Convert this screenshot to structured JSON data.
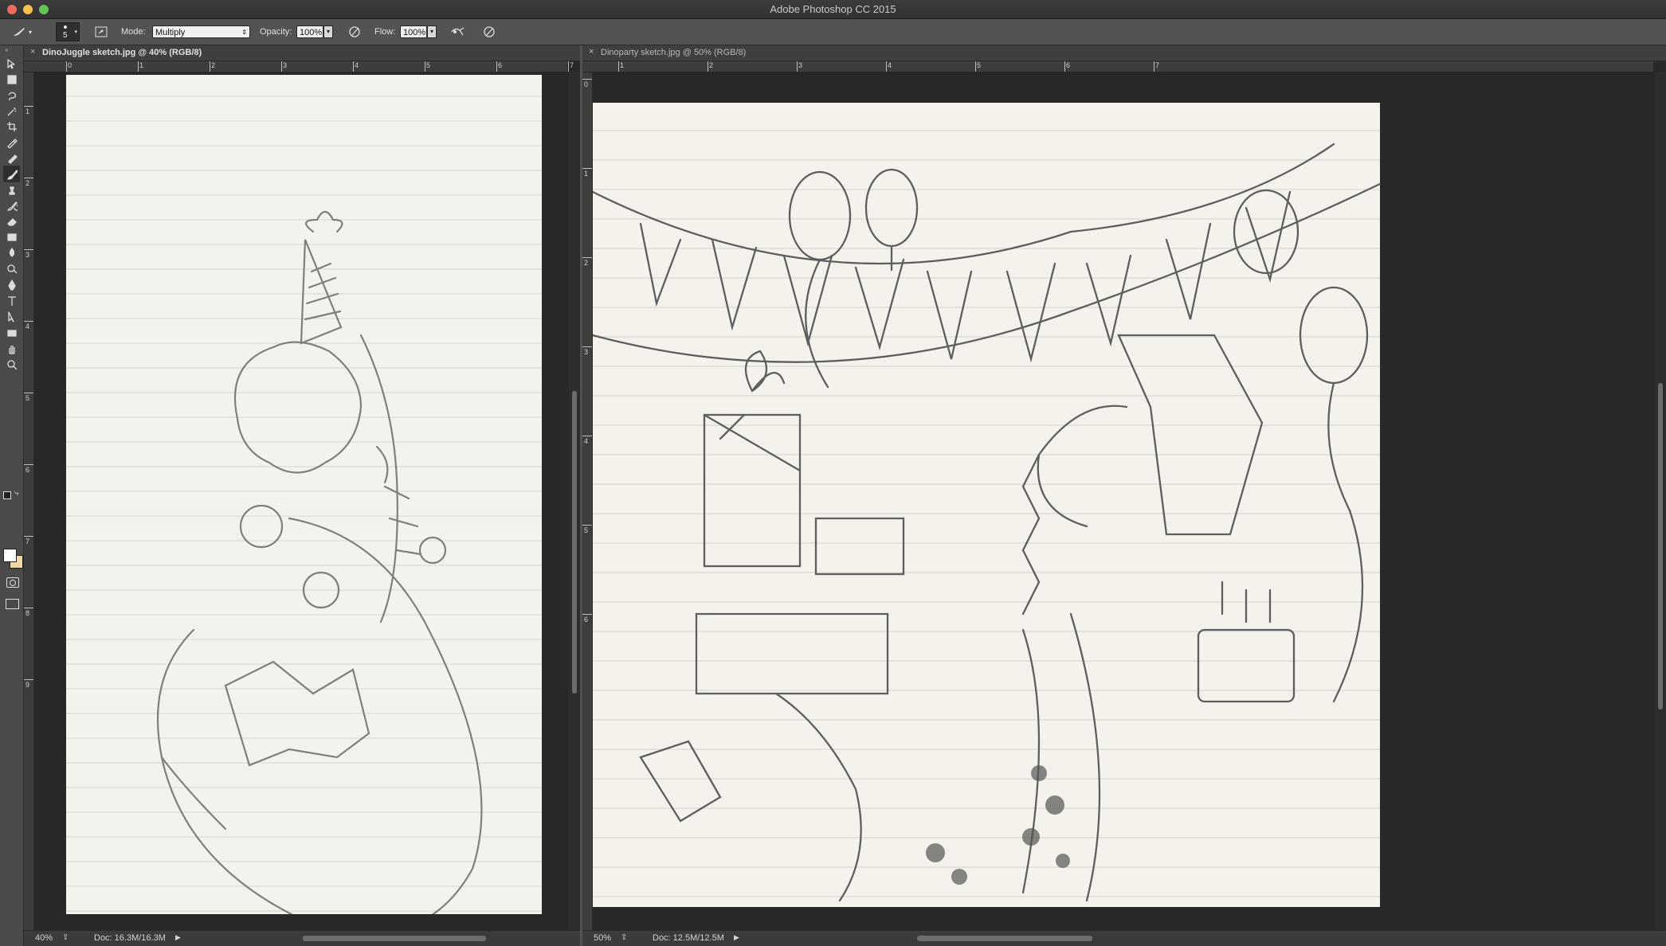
{
  "app": {
    "title": "Adobe Photoshop CC 2015"
  },
  "options": {
    "brush_size": "5",
    "mode_label": "Mode:",
    "mode_value": "Multiply",
    "opacity_label": "Opacity:",
    "opacity_value": "100%",
    "flow_label": "Flow:",
    "flow_value": "100%"
  },
  "tools": [
    "move-tool-icon",
    "marquee-tool-icon",
    "lasso-tool-icon",
    "magic-wand-tool-icon",
    "crop-tool-icon",
    "eyedropper-tool-icon",
    "healing-brush-tool-icon",
    "brush-tool-icon",
    "clone-stamp-tool-icon",
    "history-brush-tool-icon",
    "eraser-tool-icon",
    "gradient-tool-icon",
    "blur-tool-icon",
    "dodge-tool-icon",
    "pen-tool-icon",
    "type-tool-icon",
    "path-selection-tool-icon",
    "rectangle-tool-icon",
    "hand-tool-icon",
    "zoom-tool-icon"
  ],
  "colors": {
    "foreground": "#ffffff",
    "background": "#f2d8a6"
  },
  "documents": [
    {
      "tab": "DinoJuggle sketch.jpg @ 40% (RGB/8)",
      "close": "×",
      "ruler_h": [
        "0",
        "1",
        "2",
        "3",
        "4",
        "5",
        "6",
        "7"
      ],
      "ruler_v": [
        "1",
        "2",
        "3",
        "4",
        "5",
        "6",
        "7",
        "8",
        "9"
      ],
      "zoom": "40%",
      "doc_size": "Doc: 16.3M/16.3M"
    },
    {
      "tab": "Dinoparty sketch.jpg @ 50% (RGB/8)",
      "close": "×",
      "ruler_h": [
        "1",
        "2",
        "3",
        "4",
        "5",
        "6",
        "7"
      ],
      "ruler_v": [
        "0",
        "1",
        "2",
        "3",
        "4",
        "5",
        "6"
      ],
      "zoom": "50%",
      "doc_size": "Doc: 12.5M/12.5M"
    }
  ]
}
